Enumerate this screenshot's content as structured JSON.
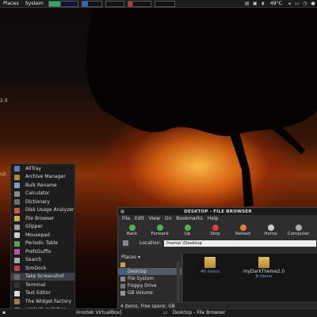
{
  "topbar": {
    "places": "Places",
    "system": "System",
    "temperature": "49°C"
  },
  "side_labels": {
    "mid": "2.0",
    "lower": "v2."
  },
  "app_menu": {
    "items": [
      {
        "label": "AllTray",
        "color": "#5a7fc0",
        "selected": false
      },
      {
        "label": "Archive Manager",
        "color": "#b8863a",
        "selected": false
      },
      {
        "label": "Bulk Rename",
        "color": "#7ea0c8",
        "selected": false
      },
      {
        "label": "Calculator",
        "color": "#8a8a8a",
        "selected": false
      },
      {
        "label": "Dictionary",
        "color": "#6f6f6f",
        "selected": false
      },
      {
        "label": "Disk Usage Analyzer",
        "color": "#c85a3a",
        "selected": false
      },
      {
        "label": "File Browser",
        "color": "#d4a84a",
        "selected": false
      },
      {
        "label": "Glipper",
        "color": "#9a9a9a",
        "selected": false
      },
      {
        "label": "Mousepad",
        "color": "#cfcfcf",
        "selected": false
      },
      {
        "label": "Periodic Table",
        "color": "#5aa05a",
        "selected": false
      },
      {
        "label": "PrefsGuffix",
        "color": "#b05aa0",
        "selected": false
      },
      {
        "label": "Search",
        "color": "#aaaaaa",
        "selected": false
      },
      {
        "label": "SimDock",
        "color": "#c04040",
        "selected": false
      },
      {
        "label": "Take Screenshot",
        "color": "#6a6a6a",
        "selected": true
      },
      {
        "label": "Terminal",
        "color": "#333333",
        "selected": false
      },
      {
        "label": "Text Editor",
        "color": "#dcdcdc",
        "selected": false
      },
      {
        "label": "The Widget Factory",
        "color": "#a07a4a",
        "selected": false
      },
      {
        "label": "usplash-switcher",
        "color": "#6a8ab0",
        "selected": false
      }
    ]
  },
  "file_browser": {
    "title": "DESKTOP - FILE BROWSER",
    "menus": [
      "File",
      "Edit",
      "View",
      "Go",
      "Bookmarks",
      "Help"
    ],
    "toolbar": [
      {
        "label": "Back",
        "color": "#4caf50"
      },
      {
        "label": "Forward",
        "color": "#4caf50"
      },
      {
        "label": "Up",
        "color": "#4caf50"
      },
      {
        "label": "Stop",
        "color": "#d94040"
      },
      {
        "label": "Reload",
        "color": "#e07b39"
      },
      {
        "label": "Home",
        "color": "#cccccc"
      },
      {
        "label": "Computer",
        "color": "#aaaaaa"
      }
    ],
    "location_label": "Location:",
    "location_value": "/home/        /Desktop",
    "places_header": "Places ▾",
    "places": [
      {
        "label": "",
        "selected": false
      },
      {
        "label": "Desktop",
        "selected": true
      },
      {
        "label": "File System",
        "selected": false
      },
      {
        "label": "Floppy Drive",
        "selected": false
      },
      {
        "label": "GB Volume",
        "selected": false
      }
    ],
    "files": [
      {
        "name": "",
        "sub": "46 items"
      },
      {
        "name": "myDarkTheme2.0",
        "sub": "8 items"
      }
    ],
    "status": "4 items, Free space:          GB"
  },
  "bottombar": {
    "task1": "innotek VirtualBox]",
    "task2": "Desktop - File Browser"
  }
}
